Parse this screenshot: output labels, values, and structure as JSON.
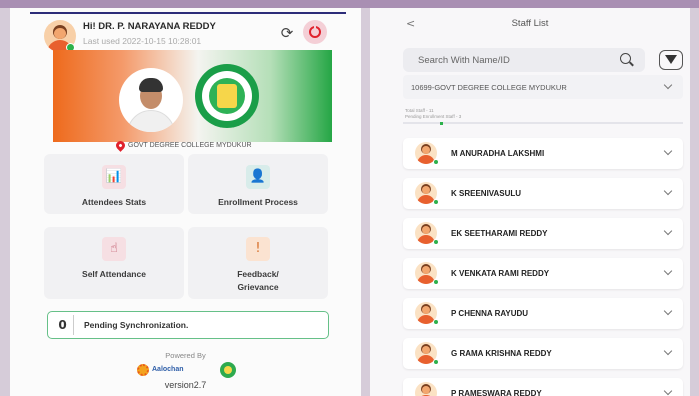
{
  "home": {
    "greeting": "Hi! DR. P. NARAYANA REDDY",
    "last_used": "Last used 2022-10-15 10:28:01",
    "college": "GOVT DEGREE COLLEGE MYDUKUR",
    "tiles": [
      {
        "label": "Attendees Stats",
        "icon": "chart-person-icon",
        "color": "#b9455a",
        "bg": "#f6dfe3"
      },
      {
        "label": "Enrollment Process",
        "icon": "face-scan-icon",
        "color": "#2f8f8a",
        "bg": "#d8ecea"
      },
      {
        "label": "Self Attendance",
        "icon": "hand-tap-icon",
        "color": "#b9455a",
        "bg": "#f6dfe3"
      },
      {
        "label": "Feedback/ Grievance",
        "icon": "feedback-icon",
        "color": "#d7702b",
        "bg": "#fbe3d1"
      }
    ],
    "pending_count": "0",
    "pending_text": "Pending Synchronization.",
    "powered_by": "Powered By",
    "brand_name": "Aalochan",
    "version": "version2.7"
  },
  "staff_list": {
    "back": "<",
    "title": "Staff List",
    "search_placeholder": "Search With Name/ID",
    "college": "10699-GOVT DEGREE COLLEGE MYDUKUR",
    "total_staff": "Total Staff - 11",
    "pending_enrollment": "Pending Enrollment Staff - 3",
    "staff": [
      "M ANURADHA LAKSHMI",
      "K SREENIVASULU",
      "EK SEETHARAMI REDDY",
      "K VENKATA RAMI REDDY",
      "P CHENNA RAYUDU",
      "G RAMA KRISHNA REDDY",
      "P RAMESWARA REDDY"
    ]
  }
}
